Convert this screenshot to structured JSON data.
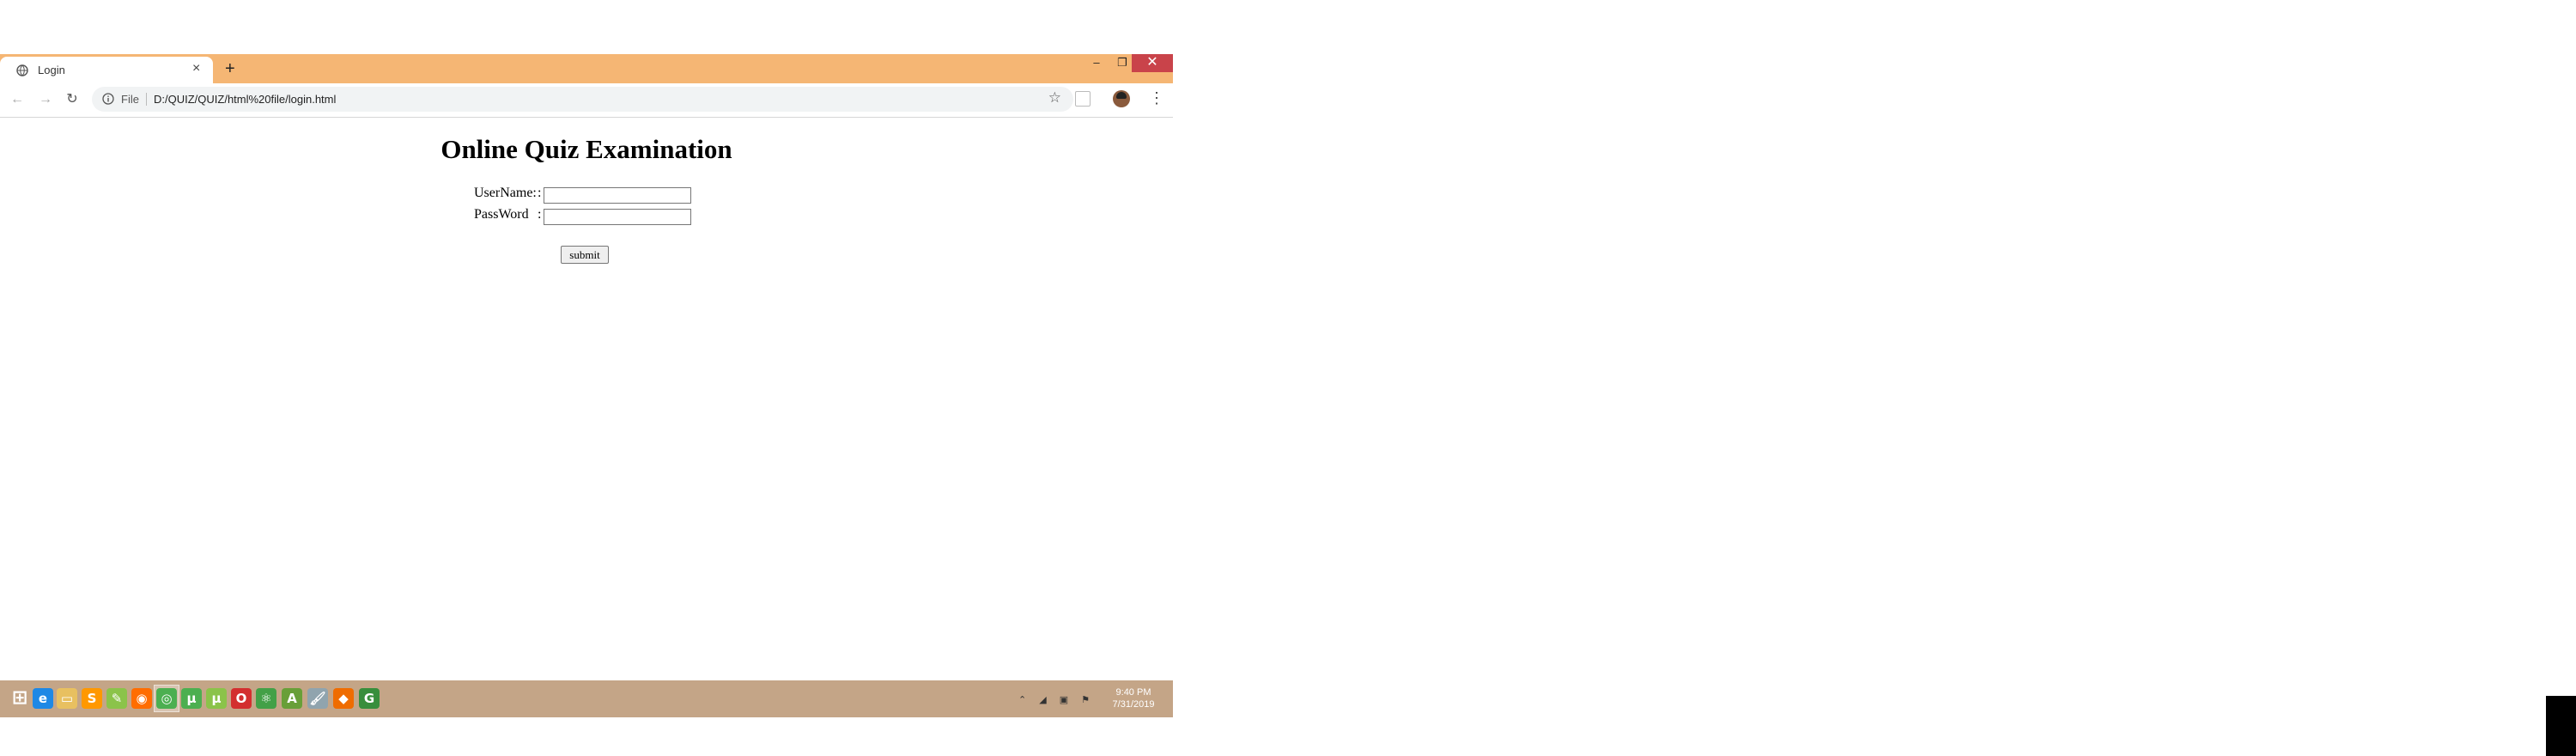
{
  "browser": {
    "tab_title": "Login",
    "tab_close": "×",
    "new_tab": "+",
    "window_controls": {
      "minimize": "–",
      "restore": "❐",
      "close": "✕"
    },
    "nav": {
      "back": "←",
      "forward": "→",
      "reload": "↻"
    },
    "address": {
      "scheme_label": "File",
      "url": "D:/QUIZ/QUIZ/html%20file/login.html",
      "star": "☆"
    },
    "menu": "⋮"
  },
  "page": {
    "heading": "Online Quiz Examination",
    "form": {
      "username_label": "UserName:",
      "password_label": "PassWord",
      "colon": ":",
      "username_value": "",
      "password_value": "",
      "submit_label": "submit"
    }
  },
  "taskbar": {
    "apps": [
      {
        "name": "start-icon",
        "glyph": "⊞",
        "color": "#ffffff"
      },
      {
        "name": "internet-explorer-icon",
        "glyph": "e",
        "color": "#1e88e5"
      },
      {
        "name": "file-explorer-icon",
        "glyph": "▭",
        "color": "#e8c060"
      },
      {
        "name": "sublime-text-icon",
        "glyph": "S",
        "color": "#ff9800"
      },
      {
        "name": "notepad-plus-plus-icon",
        "glyph": "✎",
        "color": "#8bc34a"
      },
      {
        "name": "firefox-icon",
        "glyph": "◉",
        "color": "#ff6d00"
      },
      {
        "name": "chrome-icon",
        "glyph": "◎",
        "color": "#4caf50"
      },
      {
        "name": "utorrent-icon",
        "glyph": "μ",
        "color": "#4caf50"
      },
      {
        "name": "utorrent-web-icon",
        "glyph": "μ",
        "color": "#8bc34a"
      },
      {
        "name": "opera-icon",
        "glyph": "O",
        "color": "#d32f2f"
      },
      {
        "name": "atom-icon",
        "glyph": "⚛",
        "color": "#43a047"
      },
      {
        "name": "android-studio-icon",
        "glyph": "A",
        "color": "#689f38"
      },
      {
        "name": "paint-icon",
        "glyph": "🖌",
        "color": "#90a4ae"
      },
      {
        "name": "blender-like-icon",
        "glyph": "◆",
        "color": "#ef6c00"
      },
      {
        "name": "download-icon",
        "glyph": "G",
        "color": "#388e3c"
      }
    ],
    "tray_icons": "⌃ ◢ ▣ ⚑",
    "time": "9:40 PM",
    "date": "7/31/2019"
  }
}
